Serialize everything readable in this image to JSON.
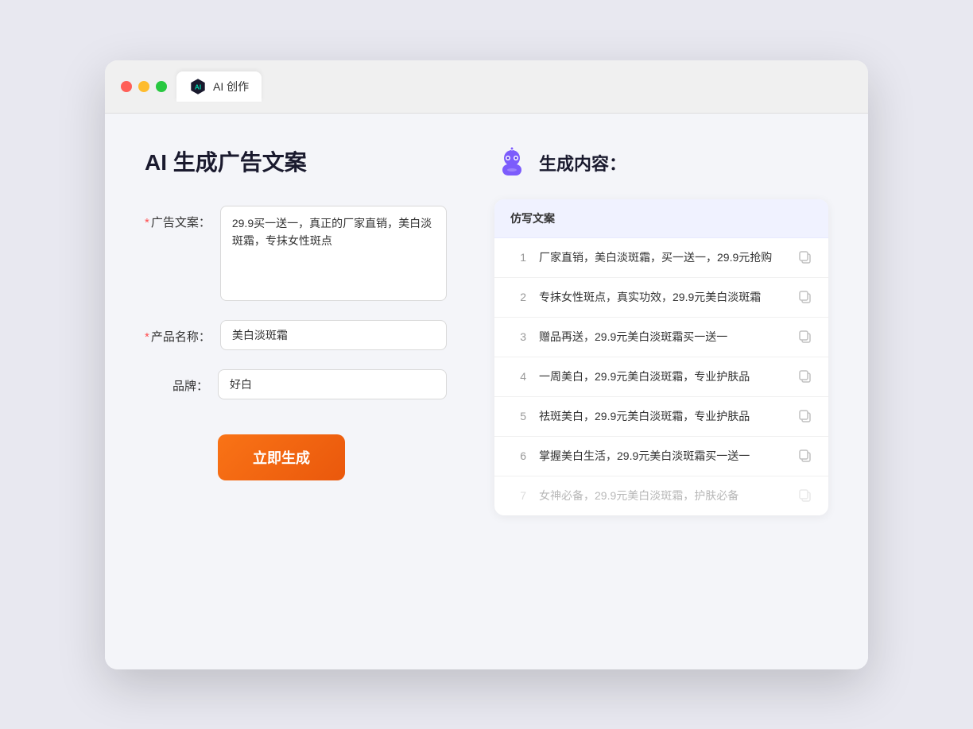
{
  "browser": {
    "tab_label": "AI 创作"
  },
  "page": {
    "title": "AI 生成广告文案",
    "right_title": "生成内容："
  },
  "form": {
    "ad_copy_label": "广告文案：",
    "ad_copy_value": "29.9买一送一，真正的厂家直销，美白淡斑霜，专抹女性斑点",
    "product_name_label": "产品名称：",
    "product_name_value": "美白淡斑霜",
    "brand_label": "品牌：",
    "brand_value": "好白",
    "generate_button": "立即生成"
  },
  "results": {
    "header": "仿写文案",
    "items": [
      {
        "num": "1",
        "text": "厂家直销，美白淡斑霜，买一送一，29.9元抢购",
        "faded": false
      },
      {
        "num": "2",
        "text": "专抹女性斑点，真实功效，29.9元美白淡斑霜",
        "faded": false
      },
      {
        "num": "3",
        "text": "赠品再送，29.9元美白淡斑霜买一送一",
        "faded": false
      },
      {
        "num": "4",
        "text": "一周美白，29.9元美白淡斑霜，专业护肤品",
        "faded": false
      },
      {
        "num": "5",
        "text": "祛斑美白，29.9元美白淡斑霜，专业护肤品",
        "faded": false
      },
      {
        "num": "6",
        "text": "掌握美白生活，29.9元美白淡斑霜买一送一",
        "faded": false
      },
      {
        "num": "7",
        "text": "女神必备，29.9元美白淡斑霜，护肤必备",
        "faded": true
      }
    ]
  }
}
